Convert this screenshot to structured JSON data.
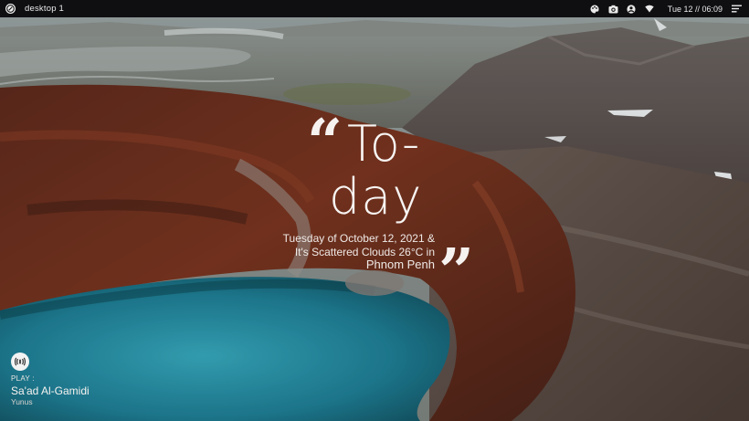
{
  "topbar": {
    "workspace_label": "desktop 1",
    "clock": "Tue 12 // 06:09",
    "tray_icons": [
      "palette-icon",
      "camera-icon",
      "account-icon",
      "wifi-icon"
    ],
    "menu_icon": "hamburger-menu-icon"
  },
  "quote_widget": {
    "line_1": "To-",
    "line_2": "day",
    "date_text": "Tuesday of October 12, 2021 &",
    "weather_text": "It's Scattered Clouds 26°C in",
    "city": "Phnom Penh"
  },
  "music_widget": {
    "play_label": "PLAY :",
    "artist": "Sa'ad Al-Gamidi",
    "track": "Yunus"
  },
  "colors": {
    "topbar_bg": "#0f0f12",
    "text_light": "#f4f0ee",
    "lake": "#1f8aa0"
  }
}
